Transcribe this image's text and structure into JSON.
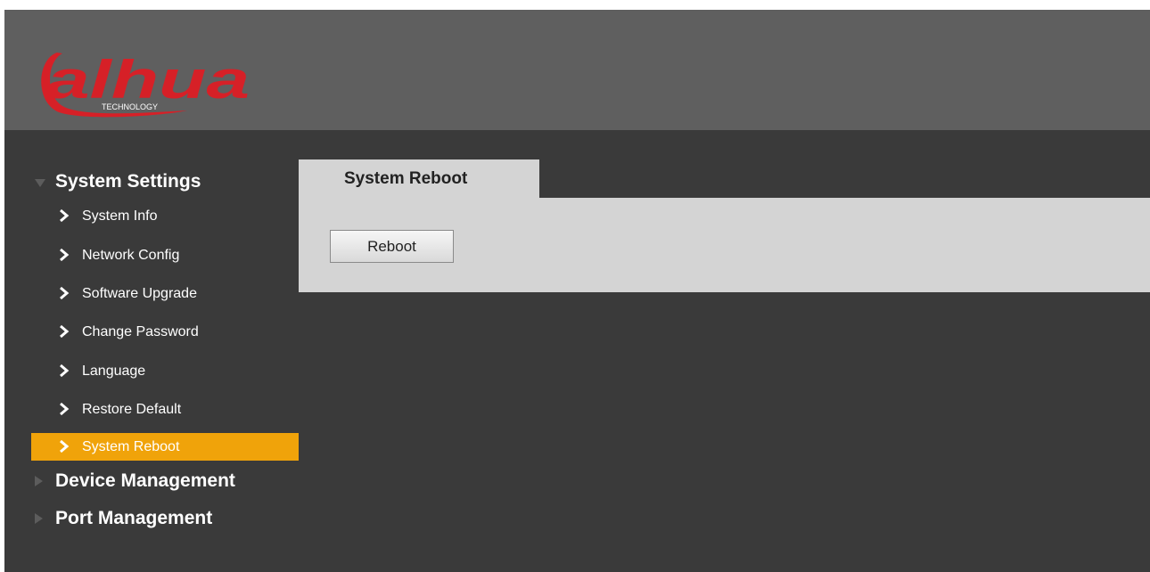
{
  "brand": {
    "logo_text": "alhua",
    "logo_subtext": "TECHNOLOGY",
    "logo_icon": "dahua-logo",
    "logo_color": "#d62027"
  },
  "colors": {
    "header_bg": "#5f5f5f",
    "body_bg": "#3a3a3a",
    "panel_bg": "#d4d4d4",
    "active_item_bg": "#f0a30a",
    "text_light": "#ffffff"
  },
  "sidebar": {
    "groups": [
      {
        "label": "System Settings",
        "expanded": true,
        "icon": "triangle-down-icon",
        "items": [
          {
            "label": "System Info",
            "icon": "chevron-right-icon",
            "active": false
          },
          {
            "label": "Network Config",
            "icon": "chevron-right-icon",
            "active": false
          },
          {
            "label": "Software Upgrade",
            "icon": "chevron-right-icon",
            "active": false
          },
          {
            "label": "Change Password",
            "icon": "chevron-right-icon",
            "active": false
          },
          {
            "label": "Language",
            "icon": "chevron-right-icon",
            "active": false
          },
          {
            "label": "Restore Default",
            "icon": "chevron-right-icon",
            "active": false
          },
          {
            "label": "System Reboot",
            "icon": "chevron-right-icon",
            "active": true
          }
        ]
      },
      {
        "label": "Device Management",
        "expanded": false,
        "icon": "triangle-right-icon"
      },
      {
        "label": "Port Management",
        "expanded": false,
        "icon": "triangle-right-icon"
      }
    ]
  },
  "main": {
    "tab_label": "System Reboot",
    "reboot_button_label": "Reboot"
  }
}
